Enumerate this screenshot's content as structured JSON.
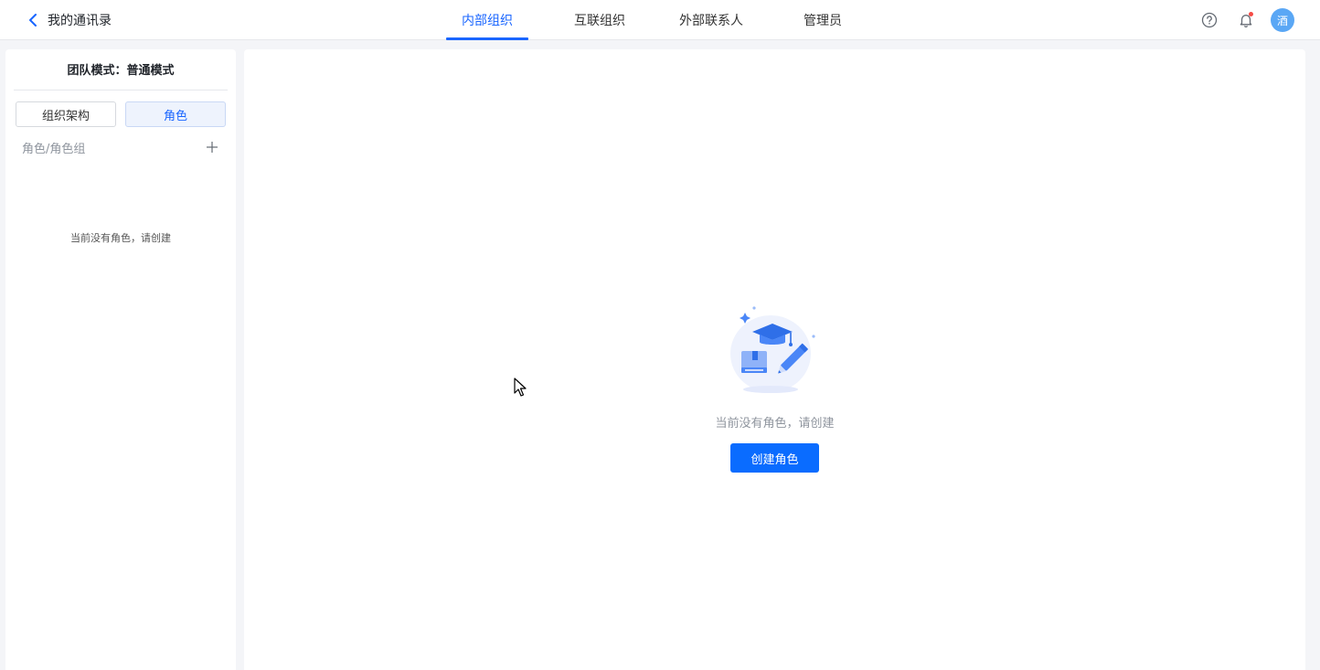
{
  "header": {
    "back_title": "我的通讯录",
    "tabs": [
      {
        "label": "内部组织",
        "active": true
      },
      {
        "label": "互联组织",
        "active": false
      },
      {
        "label": "外部联系人",
        "active": false
      },
      {
        "label": "管理员",
        "active": false
      }
    ],
    "avatar_text": "酒",
    "accent_color": "#1a66ff"
  },
  "left_panel": {
    "team_mode": "团队模式：普通模式",
    "segments": [
      {
        "label": "组织架构",
        "active": false
      },
      {
        "label": "角色",
        "active": true
      }
    ],
    "role_group_label": "角色/角色组",
    "empty_text": "当前没有角色，请创建"
  },
  "main": {
    "empty_text": "当前没有角色，请创建",
    "create_button": "创建角色"
  }
}
